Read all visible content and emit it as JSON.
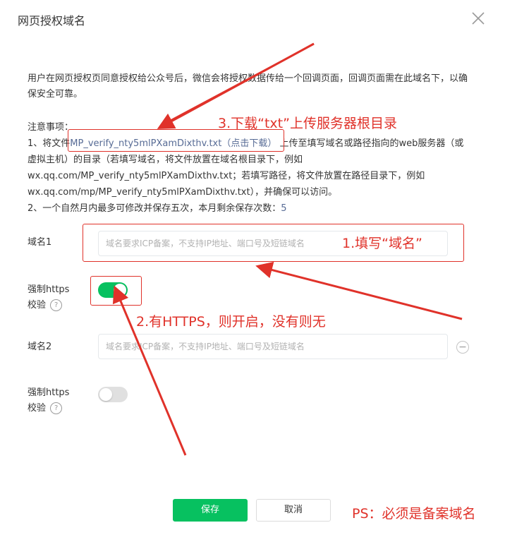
{
  "dialog": {
    "title": "网页授权域名",
    "close_icon": "close-icon"
  },
  "description": "用户在网页授权页同意授权给公众号后，微信会将授权数据传给一个回调页面，回调页面需在此域名下，以确保安全可靠。",
  "notes": {
    "title": "注意事项：",
    "item1_prefix": "1、将文件",
    "file_name": "MP_verify_nty5mlPXamDixthv.txt",
    "download_label": "（点击下载）",
    "item1_suffix": "上传至填写域名或路径指向的web服务器（或虚拟主机）的目录（若填写域名，将文件放置在域名根目录下，例如wx.qq.com/MP_verify_nty5mlPXamDixthv.txt；若填写路径，将文件放置在路径目录下，例如wx.qq.com/mp/MP_verify_nty5mlPXamDixthv.txt），并确保可以访问。",
    "item2_prefix": "2、一个自然月内最多可修改并保存五次，本月剩余保存次数：",
    "remaining": "5"
  },
  "domain1": {
    "label": "域名1",
    "placeholder": "域名要求ICP备案，不支持IP地址、端口号及短链域名",
    "value": ""
  },
  "https1": {
    "label_line1": "强制https",
    "label_line2": "校验",
    "help": "?",
    "enabled": true
  },
  "domain2": {
    "label": "域名2",
    "placeholder": "域名要求ICP备案，不支持IP地址、端口号及短链域名",
    "value": "",
    "remove_symbol": "−"
  },
  "https2": {
    "label_line1": "强制https",
    "label_line2": "校验",
    "help": "?",
    "enabled": false
  },
  "actions": {
    "save_label": "保存",
    "cancel_label": "取消"
  },
  "annotations": {
    "step1": "1.填写“域名”",
    "step2": "2.有HTTPS，则开启，没有则无",
    "step3": "3.下载“txt”上传服务器根目录",
    "ps": "PS：必须是备案域名",
    "color": "#e0322a"
  },
  "colors": {
    "accent_green": "#07c160",
    "link_blue": "#576b95",
    "annotation_red": "#e0322a"
  }
}
